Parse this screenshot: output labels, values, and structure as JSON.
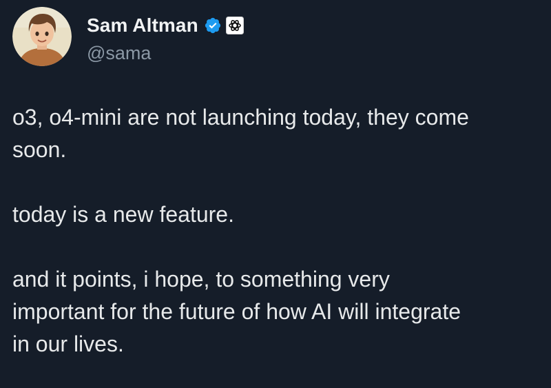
{
  "author": {
    "display_name": "Sam Altman",
    "handle": "@sama",
    "verified_badge_icon": "verified-check-icon",
    "affiliation_badge_icon": "openai-logo-icon",
    "verified_color": "#1d9bf0"
  },
  "tweet": {
    "paragraphs": [
      "o3, o4-mini are not launching today, they come\nsoon.",
      "today is a new feature.",
      "and it points, i hope, to something very\nimportant for the future of how AI will integrate\nin our lives."
    ]
  },
  "theme": {
    "background": "#151d29",
    "text": "#e7e9ea",
    "secondary_text": "#8b98a5"
  }
}
